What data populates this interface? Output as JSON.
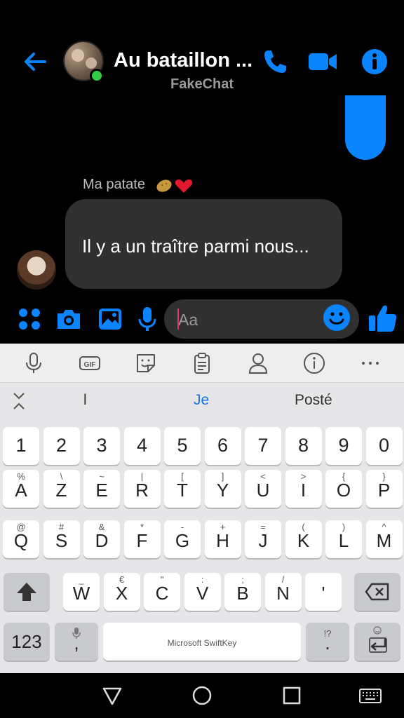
{
  "header": {
    "title": "Au bataillon ...",
    "subtitle": "FakeChat",
    "back_icon": "arrow-left-icon",
    "call_icon": "phone-icon",
    "video_icon": "video-camera-icon",
    "info_icon": "info-icon",
    "accent": "#0a84ff",
    "online": "#31cc46"
  },
  "messages": [
    {
      "direction": "sent",
      "text": ""
    },
    {
      "direction": "received",
      "sender": "Ma patate",
      "sender_emoji": "🥔❤️",
      "text": "Il y a un traître parmi nous..."
    }
  ],
  "composer": {
    "placeholder": "Aa",
    "icons": [
      "apps-icon",
      "camera-icon",
      "image-icon",
      "microphone-icon",
      "emoji-icon",
      "thumbs-up-icon"
    ]
  },
  "keyboard": {
    "toolbar": [
      "microphone-icon",
      "gif-icon",
      "sticker-icon",
      "clipboard-icon",
      "profile-icon",
      "info-icon",
      "more-icon"
    ],
    "suggestions": [
      "l",
      "Je",
      "Posté"
    ],
    "number_row": [
      "1",
      "2",
      "3",
      "4",
      "5",
      "6",
      "7",
      "8",
      "9",
      "0"
    ],
    "row1": [
      {
        "main": "A",
        "sub": "%"
      },
      {
        "main": "Z",
        "sub": "\\"
      },
      {
        "main": "E",
        "sub": "~"
      },
      {
        "main": "R",
        "sub": "|"
      },
      {
        "main": "T",
        "sub": "["
      },
      {
        "main": "Y",
        "sub": "]"
      },
      {
        "main": "U",
        "sub": "<"
      },
      {
        "main": "I",
        "sub": ">"
      },
      {
        "main": "O",
        "sub": "{"
      },
      {
        "main": "P",
        "sub": "}"
      }
    ],
    "row2": [
      {
        "main": "Q",
        "sub": "@"
      },
      {
        "main": "S",
        "sub": "#"
      },
      {
        "main": "D",
        "sub": "&"
      },
      {
        "main": "F",
        "sub": "*"
      },
      {
        "main": "G",
        "sub": "-"
      },
      {
        "main": "H",
        "sub": "+"
      },
      {
        "main": "J",
        "sub": "="
      },
      {
        "main": "K",
        "sub": "("
      },
      {
        "main": "L",
        "sub": ")"
      },
      {
        "main": "M",
        "sub": "^"
      }
    ],
    "row3": [
      {
        "main": "W",
        "sub": "_"
      },
      {
        "main": "X",
        "sub": "€"
      },
      {
        "main": "C",
        "sub": "\""
      },
      {
        "main": "V",
        "sub": ":"
      },
      {
        "main": "B",
        "sub": ";"
      },
      {
        "main": "N",
        "sub": "/"
      },
      {
        "main": "'",
        "sub": ""
      }
    ],
    "bottom": {
      "numbers_label": "123",
      "comma": ",",
      "space_brand": "Microsoft SwiftKey",
      "period": ".",
      "period_sub": "!?"
    }
  },
  "navbar": [
    "back-triangle-icon",
    "home-circle-icon",
    "recents-square-icon",
    "keyboard-icon"
  ]
}
